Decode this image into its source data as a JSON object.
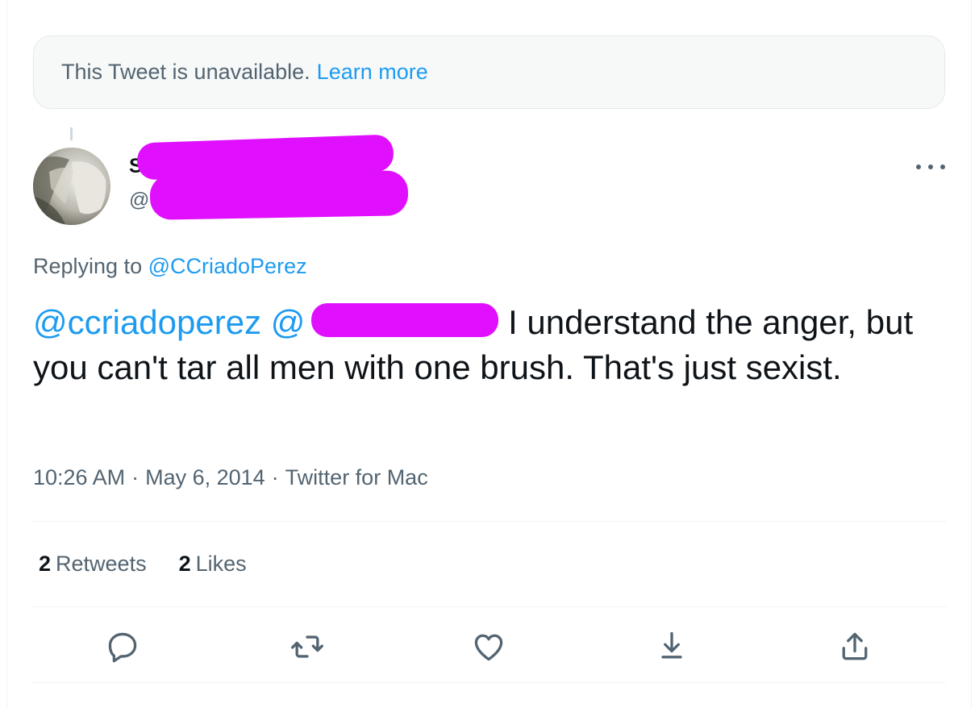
{
  "notice": {
    "text": "This Tweet is unavailable.",
    "link": "Learn more"
  },
  "tweet": {
    "replying_prefix": "Replying to",
    "replying_to": "@CCriadoPerez",
    "text_mention_1": "@ccriadoperez",
    "text_mention_2": "@",
    "text_body": " I understand the anger, but you can't tar all men with one brush. That's just sexist.",
    "time": "10:26 AM",
    "date": "May 6, 2014",
    "client": "Twitter for Mac",
    "separator": "·"
  },
  "stats": {
    "retweets_count": "2",
    "retweets_label": "Retweets",
    "likes_count": "2",
    "likes_label": "Likes"
  },
  "icons": {
    "reply": "reply-icon",
    "retweet": "retweet-icon",
    "like": "heart-icon",
    "bookmark": "bookmark-down-icon",
    "share": "share-icon",
    "more": "more-icon"
  },
  "colors": {
    "link": "#1d9bf0",
    "secondary_text": "#536471",
    "redaction": "#e010ff"
  }
}
